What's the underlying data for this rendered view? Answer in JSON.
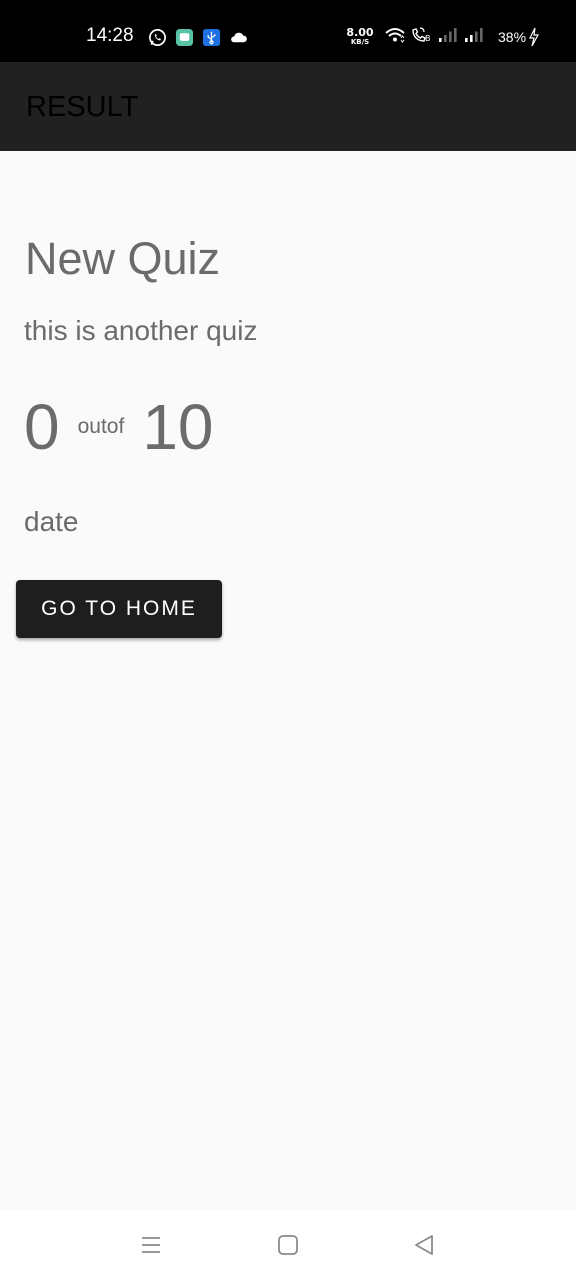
{
  "status_bar": {
    "time": "14:28",
    "network_speed_value": "8.00",
    "network_speed_unit": "KB/S",
    "battery_percent": "38%",
    "icons": [
      "whatsapp-icon",
      "message-app-icon",
      "usb-icon",
      "cloud-icon",
      "wifi-icon",
      "volte-call-icon",
      "signal-icon",
      "signal-icon",
      "charging-bolt-icon"
    ]
  },
  "app_bar": {
    "title": "RESULT"
  },
  "quiz": {
    "title": "New Quiz",
    "description": "this is another quiz",
    "score": "0",
    "outof_label": "outof",
    "total": "10",
    "date": "date"
  },
  "actions": {
    "home_button_label": "GO TO HOME"
  },
  "nav_bar": {
    "icons": [
      "recents-menu-icon",
      "home-square-icon",
      "back-triangle-icon"
    ]
  },
  "colors": {
    "status_bar_bg": "#000000",
    "app_bar_bg": "#212121",
    "page_bg": "#fafafa",
    "text_gray": "#6b6b6b",
    "button_bg": "#1e1e1e",
    "button_text": "#ffffff"
  }
}
